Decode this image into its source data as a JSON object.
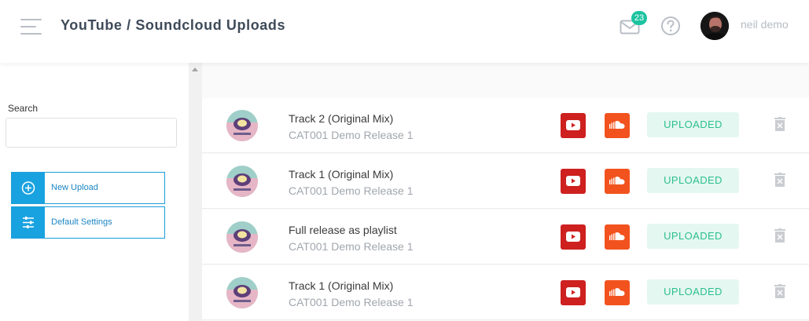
{
  "header": {
    "title": "YouTube / Soundcloud Uploads",
    "notification_count": "23",
    "user_name": "neil demo"
  },
  "sidebar": {
    "search_label": "Search",
    "search_value": "",
    "buttons": [
      {
        "label": "New Upload",
        "icon": "plus-circle-icon"
      },
      {
        "label": "Default Settings",
        "icon": "sliders-icon"
      }
    ]
  },
  "uploads": [
    {
      "title": "Track 2 (Original Mix)",
      "release": "CAT001 Demo Release 1",
      "status": "UPLOADED"
    },
    {
      "title": "Track 1 (Original Mix)",
      "release": "CAT001 Demo Release 1",
      "status": "UPLOADED"
    },
    {
      "title": "Full release as playlist",
      "release": "CAT001 Demo Release 1",
      "status": "UPLOADED"
    },
    {
      "title": "Track 1 (Original Mix)",
      "release": "CAT001 Demo Release 1",
      "status": "UPLOADED"
    }
  ],
  "colors": {
    "accent": "#19a2e0",
    "badge": "#1bc3a0",
    "youtube": "#cd201f",
    "soundcloud": "#f2531e",
    "status_text": "#2cbf8f",
    "status_bg": "#e5f7f1"
  }
}
